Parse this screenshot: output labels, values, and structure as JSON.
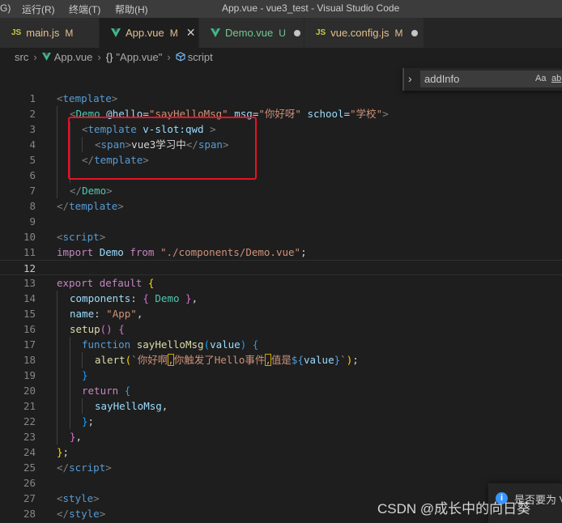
{
  "titlebar": {
    "menu": [
      {
        "label": "G)"
      },
      {
        "label": "运行(R)"
      },
      {
        "label": "终端(T)"
      },
      {
        "label": "帮助(H)"
      }
    ],
    "window_title": "App.vue - vue3_test - Visual Studio Code"
  },
  "tabs": [
    {
      "icon": "JS",
      "name": "main.js",
      "badge": "M",
      "state": "modified"
    },
    {
      "name": "App.vue",
      "badge": "M",
      "state": "active",
      "close": "✕"
    },
    {
      "name": "Demo.vue",
      "badge": "U",
      "state": "untracked"
    },
    {
      "icon": "JS",
      "name": "vue.config.js",
      "badge": "M",
      "state": "modified"
    }
  ],
  "breadcrumb": {
    "items": [
      "src",
      "App.vue",
      "\"App.vue\"",
      "script"
    ],
    "curly": "{}",
    "separator": "›"
  },
  "find": {
    "value": "addInfo",
    "chevron": "›",
    "match_case": "Aa",
    "whole_word": "ab"
  },
  "editor": {
    "current_line": 12,
    "line_numbers": [
      "1",
      "2",
      "3",
      "4",
      "5",
      "6",
      "7",
      "8",
      "9",
      "10",
      "11",
      "12",
      "13",
      "14",
      "15",
      "16",
      "17",
      "18",
      "19",
      "20",
      "21",
      "22",
      "23",
      "24",
      "25",
      "26",
      "27",
      "28"
    ]
  },
  "notification": {
    "icon": "i",
    "text": "是否要为 V"
  },
  "watermark": "CSDN @成长中的向日葵",
  "colors": {
    "accent_red": "#e81123",
    "vue_green": "#41b883",
    "js_yellow": "#cbcb41"
  }
}
